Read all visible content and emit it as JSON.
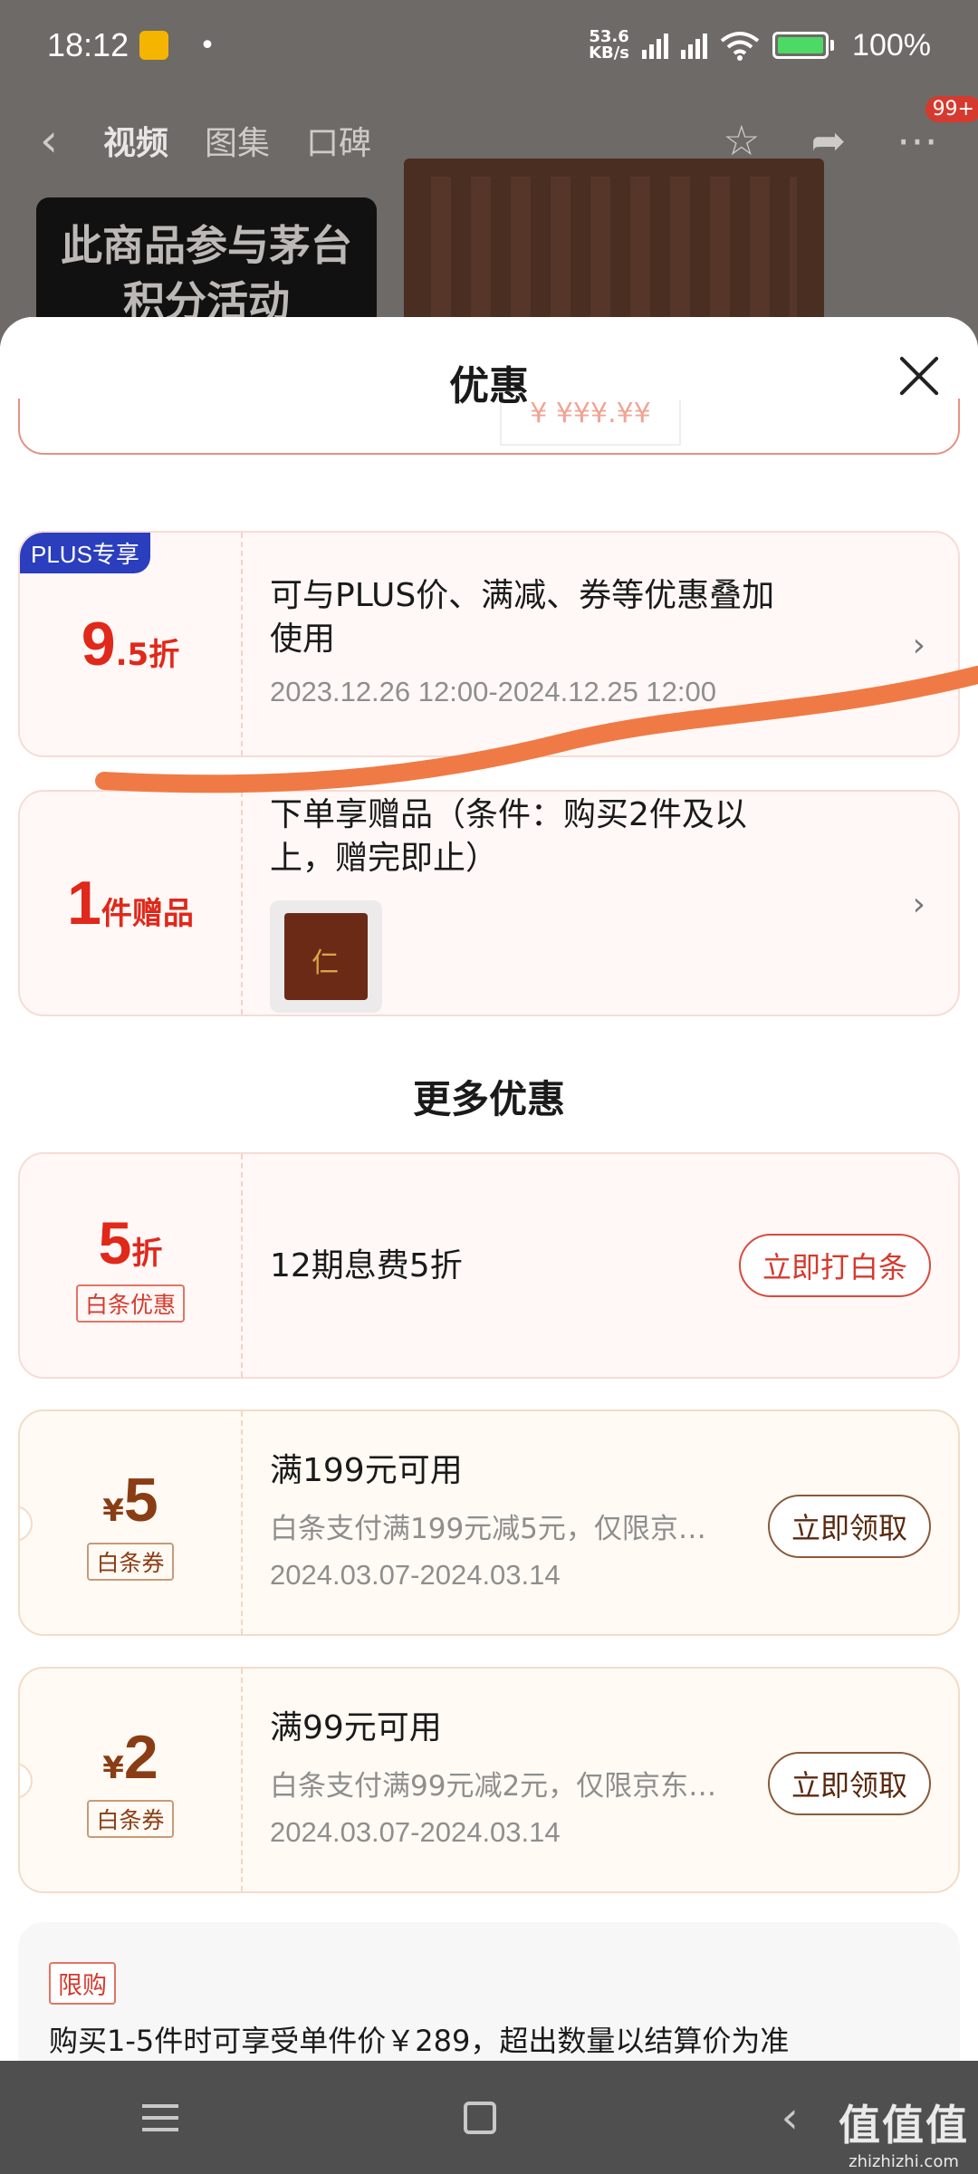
{
  "status_bar": {
    "time": "18:12",
    "dot": "•",
    "speed_top": "53.6",
    "speed_bottom": "KB/s",
    "battery": "100%"
  },
  "nav": {
    "back": "‹",
    "tabs": [
      "视频",
      "图集",
      "口碑"
    ],
    "badge": "99+"
  },
  "banner": {
    "line1": "此商品参与茅台",
    "line2": "积分活动"
  },
  "sheet": {
    "title": "优惠",
    "partial_fragment": "¥ ¥¥¥.¥¥"
  },
  "plus_card": {
    "badge": "PLUS专享",
    "int": "9",
    "dec": ".5",
    "unit": "折",
    "line1": "可与PLUS价、满减、券等优惠叠加",
    "line2": "使用",
    "date": "2023.12.26 12:00-2024.12.25 12:00"
  },
  "gift_card": {
    "num": "1",
    "unit": "件赠品",
    "line1": "下单享赠品（条件：购买2件及以",
    "line2": "上，赠完即止）"
  },
  "more_title": "更多优惠",
  "baitiao_card": {
    "num": "5",
    "unit": "折",
    "tag": "白条优惠",
    "desc": "12期息费5折",
    "button": "立即打白条"
  },
  "coupons": [
    {
      "currency": "¥",
      "amount": "5",
      "tag": "白条券",
      "title": "满199元可用",
      "sub": "白条支付满199元减5元，仅限京东…",
      "date": "2024.03.07-2024.03.14",
      "button": "立即领取"
    },
    {
      "currency": "¥",
      "amount": "2",
      "tag": "白条券",
      "title": "满99元可用",
      "sub": "白条支付满99元减2元，仅限京东商…",
      "date": "2024.03.07-2024.03.14",
      "button": "立即领取"
    }
  ],
  "limit": {
    "tag": "限购",
    "text": "购买1-5件时可享受单件价￥289，超出数量以结算价为准"
  },
  "watermark": {
    "big": "值值值",
    "small": "zhizhizhi.com"
  },
  "colors": {
    "accent_red": "#e0281b",
    "plus_blue": "#2b3ebd",
    "coupon_brown": "#8a3d14",
    "annotation_orange": "#f07a45"
  }
}
